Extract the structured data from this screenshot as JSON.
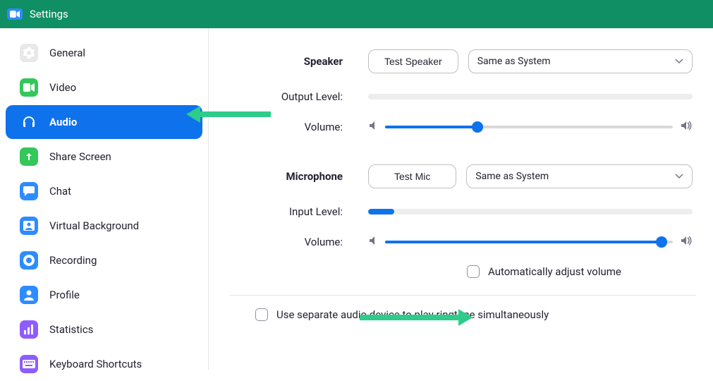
{
  "window": {
    "title": "Settings"
  },
  "sidebar": {
    "items": [
      {
        "label": "General"
      },
      {
        "label": "Video"
      },
      {
        "label": "Audio"
      },
      {
        "label": "Share Screen"
      },
      {
        "label": "Chat"
      },
      {
        "label": "Virtual Background"
      },
      {
        "label": "Recording"
      },
      {
        "label": "Profile"
      },
      {
        "label": "Statistics"
      },
      {
        "label": "Keyboard Shortcuts"
      }
    ]
  },
  "audio": {
    "speaker": {
      "heading": "Speaker",
      "test_label": "Test Speaker",
      "device": "Same as System",
      "output_level_label": "Output Level:",
      "output_level_pct": 0,
      "volume_label": "Volume:",
      "volume_pct": 32
    },
    "microphone": {
      "heading": "Microphone",
      "test_label": "Test Mic",
      "device": "Same as System",
      "input_level_label": "Input Level:",
      "input_level_pct": 8,
      "volume_label": "Volume:",
      "volume_pct": 96,
      "auto_adjust_label": "Automatically adjust volume",
      "auto_adjust_checked": false
    },
    "separate_device_label": "Use separate audio device to play ringtone simultaneously",
    "separate_device_checked": false
  }
}
